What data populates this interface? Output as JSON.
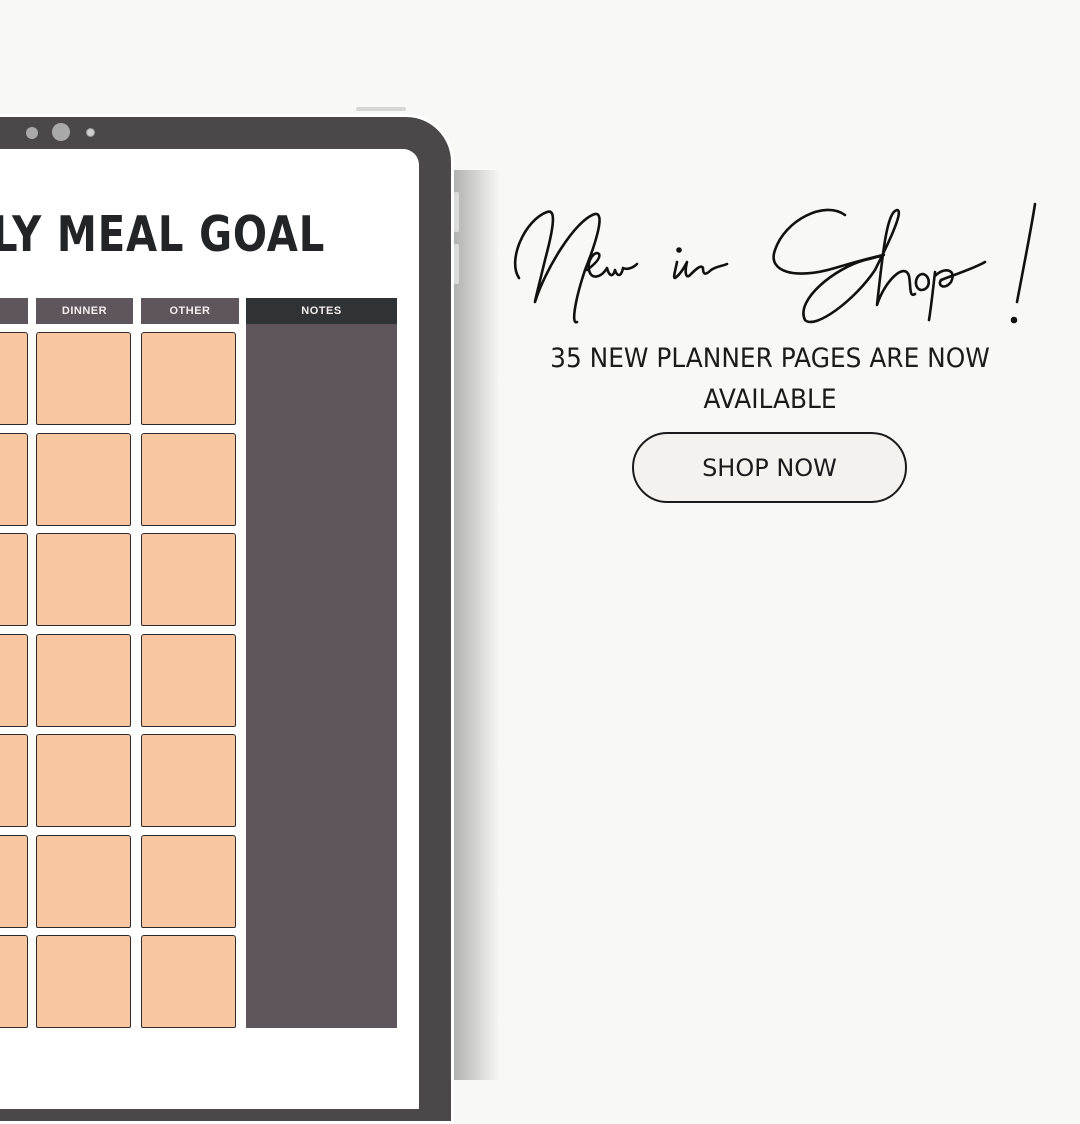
{
  "planner": {
    "title": "LY MEAL GOAL",
    "columns": [
      {
        "label": ""
      },
      {
        "label": "DINNER"
      },
      {
        "label": "OTHER"
      },
      {
        "label": "NOTES"
      }
    ],
    "rows": 7,
    "colors": {
      "cell": "#f8c6a0",
      "header": "#5f555c",
      "notes_header": "#2f3336",
      "frame": "#4a4849"
    }
  },
  "promo": {
    "headline": "New in Shop!",
    "subtitle_line1": "35 NEW PLANNER PAGES ARE NOW",
    "subtitle_line2": "AVAILABLE",
    "cta_label": "SHOP NOW"
  }
}
